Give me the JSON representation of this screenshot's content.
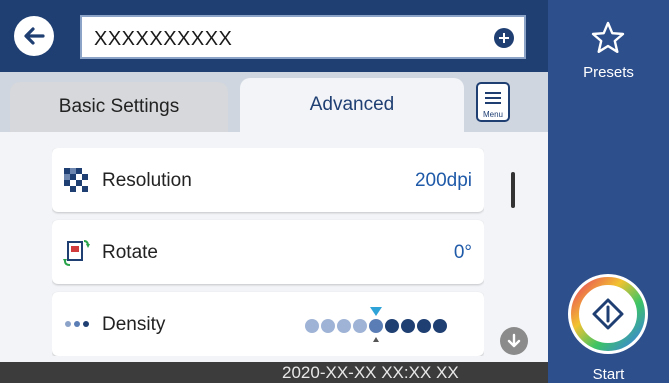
{
  "header": {
    "destination_value": "XXXXXXXXXX"
  },
  "tabs": {
    "basic_label": "Basic Settings",
    "advanced_label": "Advanced"
  },
  "menu": {
    "label": "Menu"
  },
  "settings": [
    {
      "label": "Resolution",
      "value": "200dpi",
      "icon": "resolution-icon"
    },
    {
      "label": "Rotate",
      "value": "0°",
      "icon": "rotate-icon"
    },
    {
      "label": "Density",
      "icon": "density-icon",
      "level": 5,
      "levels": 9
    }
  ],
  "status_bar": {
    "datetime": "2020-XX-XX XX:XX XX"
  },
  "side_panel": {
    "presets_label": "Presets",
    "start_label": "Start"
  },
  "colors": {
    "primary": "#1f3f73",
    "side_panel": "#2d4f8c",
    "accent_value": "#1f5aa8"
  }
}
